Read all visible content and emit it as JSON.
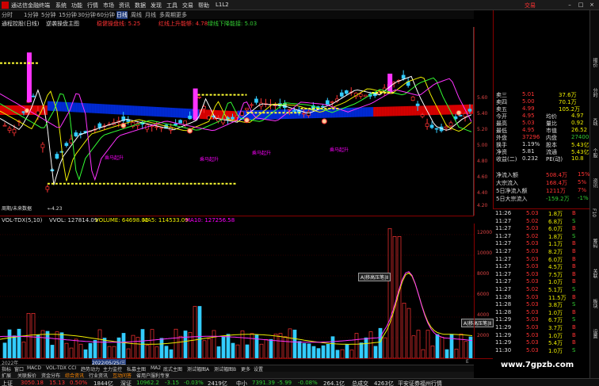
{
  "titlebar": {
    "app": "通达信金融终端",
    "menus": [
      "系统",
      "功能",
      "行情",
      "市场",
      "资讯",
      "数据",
      "发现",
      "工具",
      "交易",
      "帮助",
      "L1L2"
    ],
    "brand": "交易"
  },
  "timeframes": [
    "分时",
    "1分钟",
    "5分钟",
    "15分钟",
    "30分钟",
    "60分钟",
    "日线",
    "周线",
    "月线",
    "多周期",
    "更多"
  ],
  "timeframe_selected": "日线",
  "header": {
    "name": "通程控股(日线)",
    "indicator": "逆袭操盘主图",
    "l1": "稳健操盘线: 5.25",
    "l2": "红线上升能够: 4.78",
    "l3": "绿线下降能接: 5.03"
  },
  "main_labels": {
    "buy_up": "乘马起升",
    "low": "←4.23",
    "hl": "←5.89",
    "watermark_small": "周期/未来数据"
  },
  "main_axis": [
    "5.60",
    "5.40",
    "5.20",
    "5.00",
    "4.80",
    "4.60",
    "4.40",
    "4.20",
    "4.00"
  ],
  "vol_header": {
    "a": "VOL-TDX(5,10)",
    "b": "VVOL: 127814.09",
    "c": "VOLUME: 64698.02",
    "d": "MA5: 114533.09",
    "e": "MA10: 127256.58"
  },
  "vol_axis": [
    "12000",
    "10000",
    "8000",
    "6000",
    "4000",
    "2000"
  ],
  "date_bar": {
    "left": "2022年",
    "sel": "2022/05/25/三",
    "right": "E"
  },
  "tabs1": [
    "指标",
    "窗口",
    "MACD",
    "VOL-TDX",
    "CCI",
    "趋势动力",
    "主力监控",
    "私募主图",
    "MA2",
    "底式主图",
    "测试幅图A",
    "测试幅图B",
    "更多",
    "设置"
  ],
  "tabs2": [
    "扩展",
    "关联报价",
    "资金分布",
    "综合资讯",
    "行业资讯",
    "互动问答",
    "省用户服利专享"
  ],
  "popups": {
    "p1": "A|移高压笔|Ⅱ",
    "p2": "A|移高压笔|Ⅱ"
  },
  "quote": [
    {
      "label": "卖三",
      "price": "5.01",
      "vol": "37.6万"
    },
    {
      "label": "卖四",
      "price": "5.00",
      "vol": "70.1万"
    },
    {
      "label": "卖五",
      "price": "4.99",
      "vol": "105.2万"
    },
    {
      "label": "今开",
      "price": "4.95",
      "k2": "均价",
      "v2": "4.97"
    },
    {
      "label": "最高",
      "price": "5.03",
      "k2": "量比",
      "v2": "0.92"
    },
    {
      "label": "最低",
      "price": "4.95",
      "k2": "市值",
      "v2": "26.52"
    },
    {
      "label": "外盘",
      "price": "37296",
      "k2": "内盘",
      "v2": "27400"
    },
    {
      "label": "换手",
      "price": "1.19%",
      "k2": "股本",
      "v2": "5.43亿"
    },
    {
      "label": "净资",
      "price": "5.81",
      "k2": "流通",
      "v2": "5.43亿"
    },
    {
      "label": "收益(二)",
      "price": "0.232",
      "k2": "PE(动)",
      "v2": "10.8"
    }
  ],
  "flows": [
    {
      "label": "净流入额",
      "v": "508.4万",
      "p": "15%"
    },
    {
      "label": "大宗流入",
      "v": "168.4万",
      "p": "5%"
    },
    {
      "label": "5日净流入额",
      "v": "1211万",
      "p": "7%"
    },
    {
      "label": "5日大宗流入",
      "v": "-159.2万",
      "p": "-1%"
    }
  ],
  "ticks": [
    [
      "11:26",
      "5.03",
      "1.8万",
      "B"
    ],
    [
      "11:27",
      "5.02",
      "6.8万",
      "S"
    ],
    [
      "11:27",
      "5.03",
      "6.0万",
      "B"
    ],
    [
      "11:27",
      "5.02",
      "1.8万",
      "S"
    ],
    [
      "11:27",
      "5.03",
      "1.1万",
      "B"
    ],
    [
      "11:27",
      "5.03",
      "8.2万",
      "B"
    ],
    [
      "11:27",
      "5.03",
      "6.0万",
      "B"
    ],
    [
      "11:27",
      "5.03",
      "4.5万",
      "B"
    ],
    [
      "11:27",
      "5.03",
      "7.5万",
      "B"
    ],
    [
      "11:27",
      "5.03",
      "1.0万",
      "B"
    ],
    [
      "11:27",
      "5.02",
      "5.1万",
      "S"
    ],
    [
      "11:28",
      "5.03",
      "11.5万",
      "B"
    ],
    [
      "11:28",
      "5.03",
      "3.8万",
      "S"
    ],
    [
      "11:28",
      "5.03",
      "1.0万",
      "B"
    ],
    [
      "11:29",
      "5.03",
      "6.7万",
      "S"
    ],
    [
      "11:29",
      "5.03",
      "3.7万",
      "B"
    ],
    [
      "11:29",
      "5.03",
      "1.0万",
      "B"
    ],
    [
      "11:29",
      "5.03",
      "5.4万",
      "B"
    ],
    [
      "11:30",
      "5.03",
      "1.0万",
      "S"
    ]
  ],
  "status": {
    "a": "上证",
    "a1": "3050.18",
    "a2": "15.13",
    "a3": "0.50%",
    "a4": "1844亿",
    "b": "深证",
    "b1": "10962.2",
    "b2": "-3.15",
    "b3": "-0.03%",
    "b4": "2419亿",
    "c": "中小",
    "c1": "7391.39",
    "c2": "-5.99",
    "c3": "-0.08%",
    "c4": "264.1亿",
    "d": "总成交",
    "d1": "4263亿",
    "e": "平安证券福州行情"
  },
  "sidebar": [
    "报价",
    "分时",
    "K线",
    "个股",
    "资讯",
    "F10",
    "筹码",
    "关联",
    "板块",
    "设置"
  ],
  "watermark": "www.7gpzb.com",
  "colors": {
    "up": "#ff3333",
    "down": "#33cc33",
    "ma5": "#ffffff",
    "ma_yellow": "#eeee00",
    "cloud_red": "#ff0000",
    "cloud_blue": "#0044ff"
  }
}
